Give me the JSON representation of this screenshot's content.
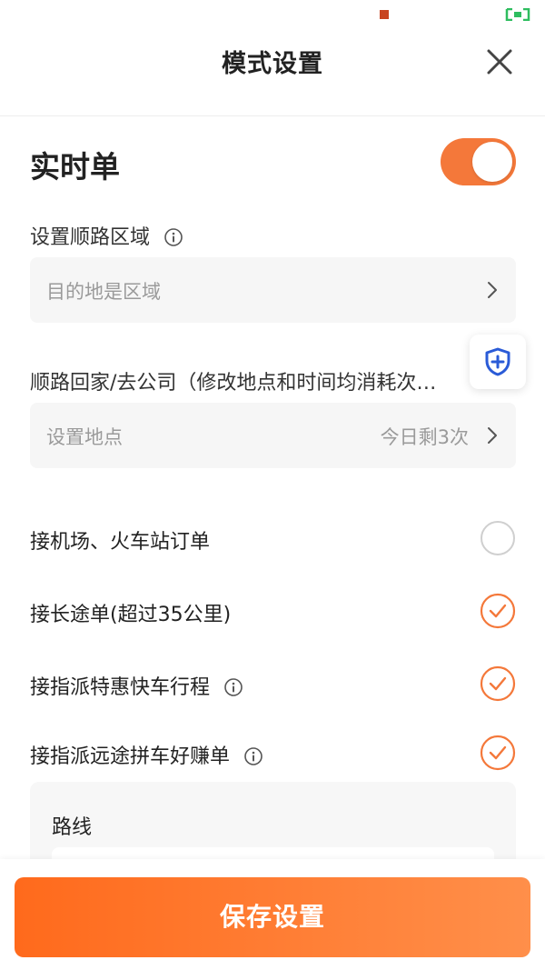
{
  "header": {
    "title": "模式设置",
    "close_icon": "close-icon"
  },
  "realtime": {
    "label": "实时单",
    "toggle_on": true,
    "toggle_color": "#f4783a"
  },
  "route_area": {
    "label": "设置顺路区域",
    "select_placeholder": "目的地是区域"
  },
  "home_company": {
    "label": "顺路回家/去公司（修改地点和时间均消耗次…",
    "select_placeholder": "设置地点",
    "remaining_text": "今日剩3次"
  },
  "options": [
    {
      "label": "接机场、火车站订单",
      "checked": false,
      "has_info": false
    },
    {
      "label": "接长途单(超过35公里)",
      "checked": true,
      "has_info": false
    },
    {
      "label": "接指派特惠快车行程",
      "checked": true,
      "has_info": true
    },
    {
      "label": "接指派远途拼车好赚单",
      "checked": true,
      "has_info": true
    }
  ],
  "route_card": {
    "title": "路线"
  },
  "footer": {
    "save_label": "保存设置"
  },
  "colors": {
    "accent": "#f4783a",
    "button_start": "#ff6a1c",
    "button_end": "#ff8f4a",
    "shield": "#2a5bd7"
  }
}
